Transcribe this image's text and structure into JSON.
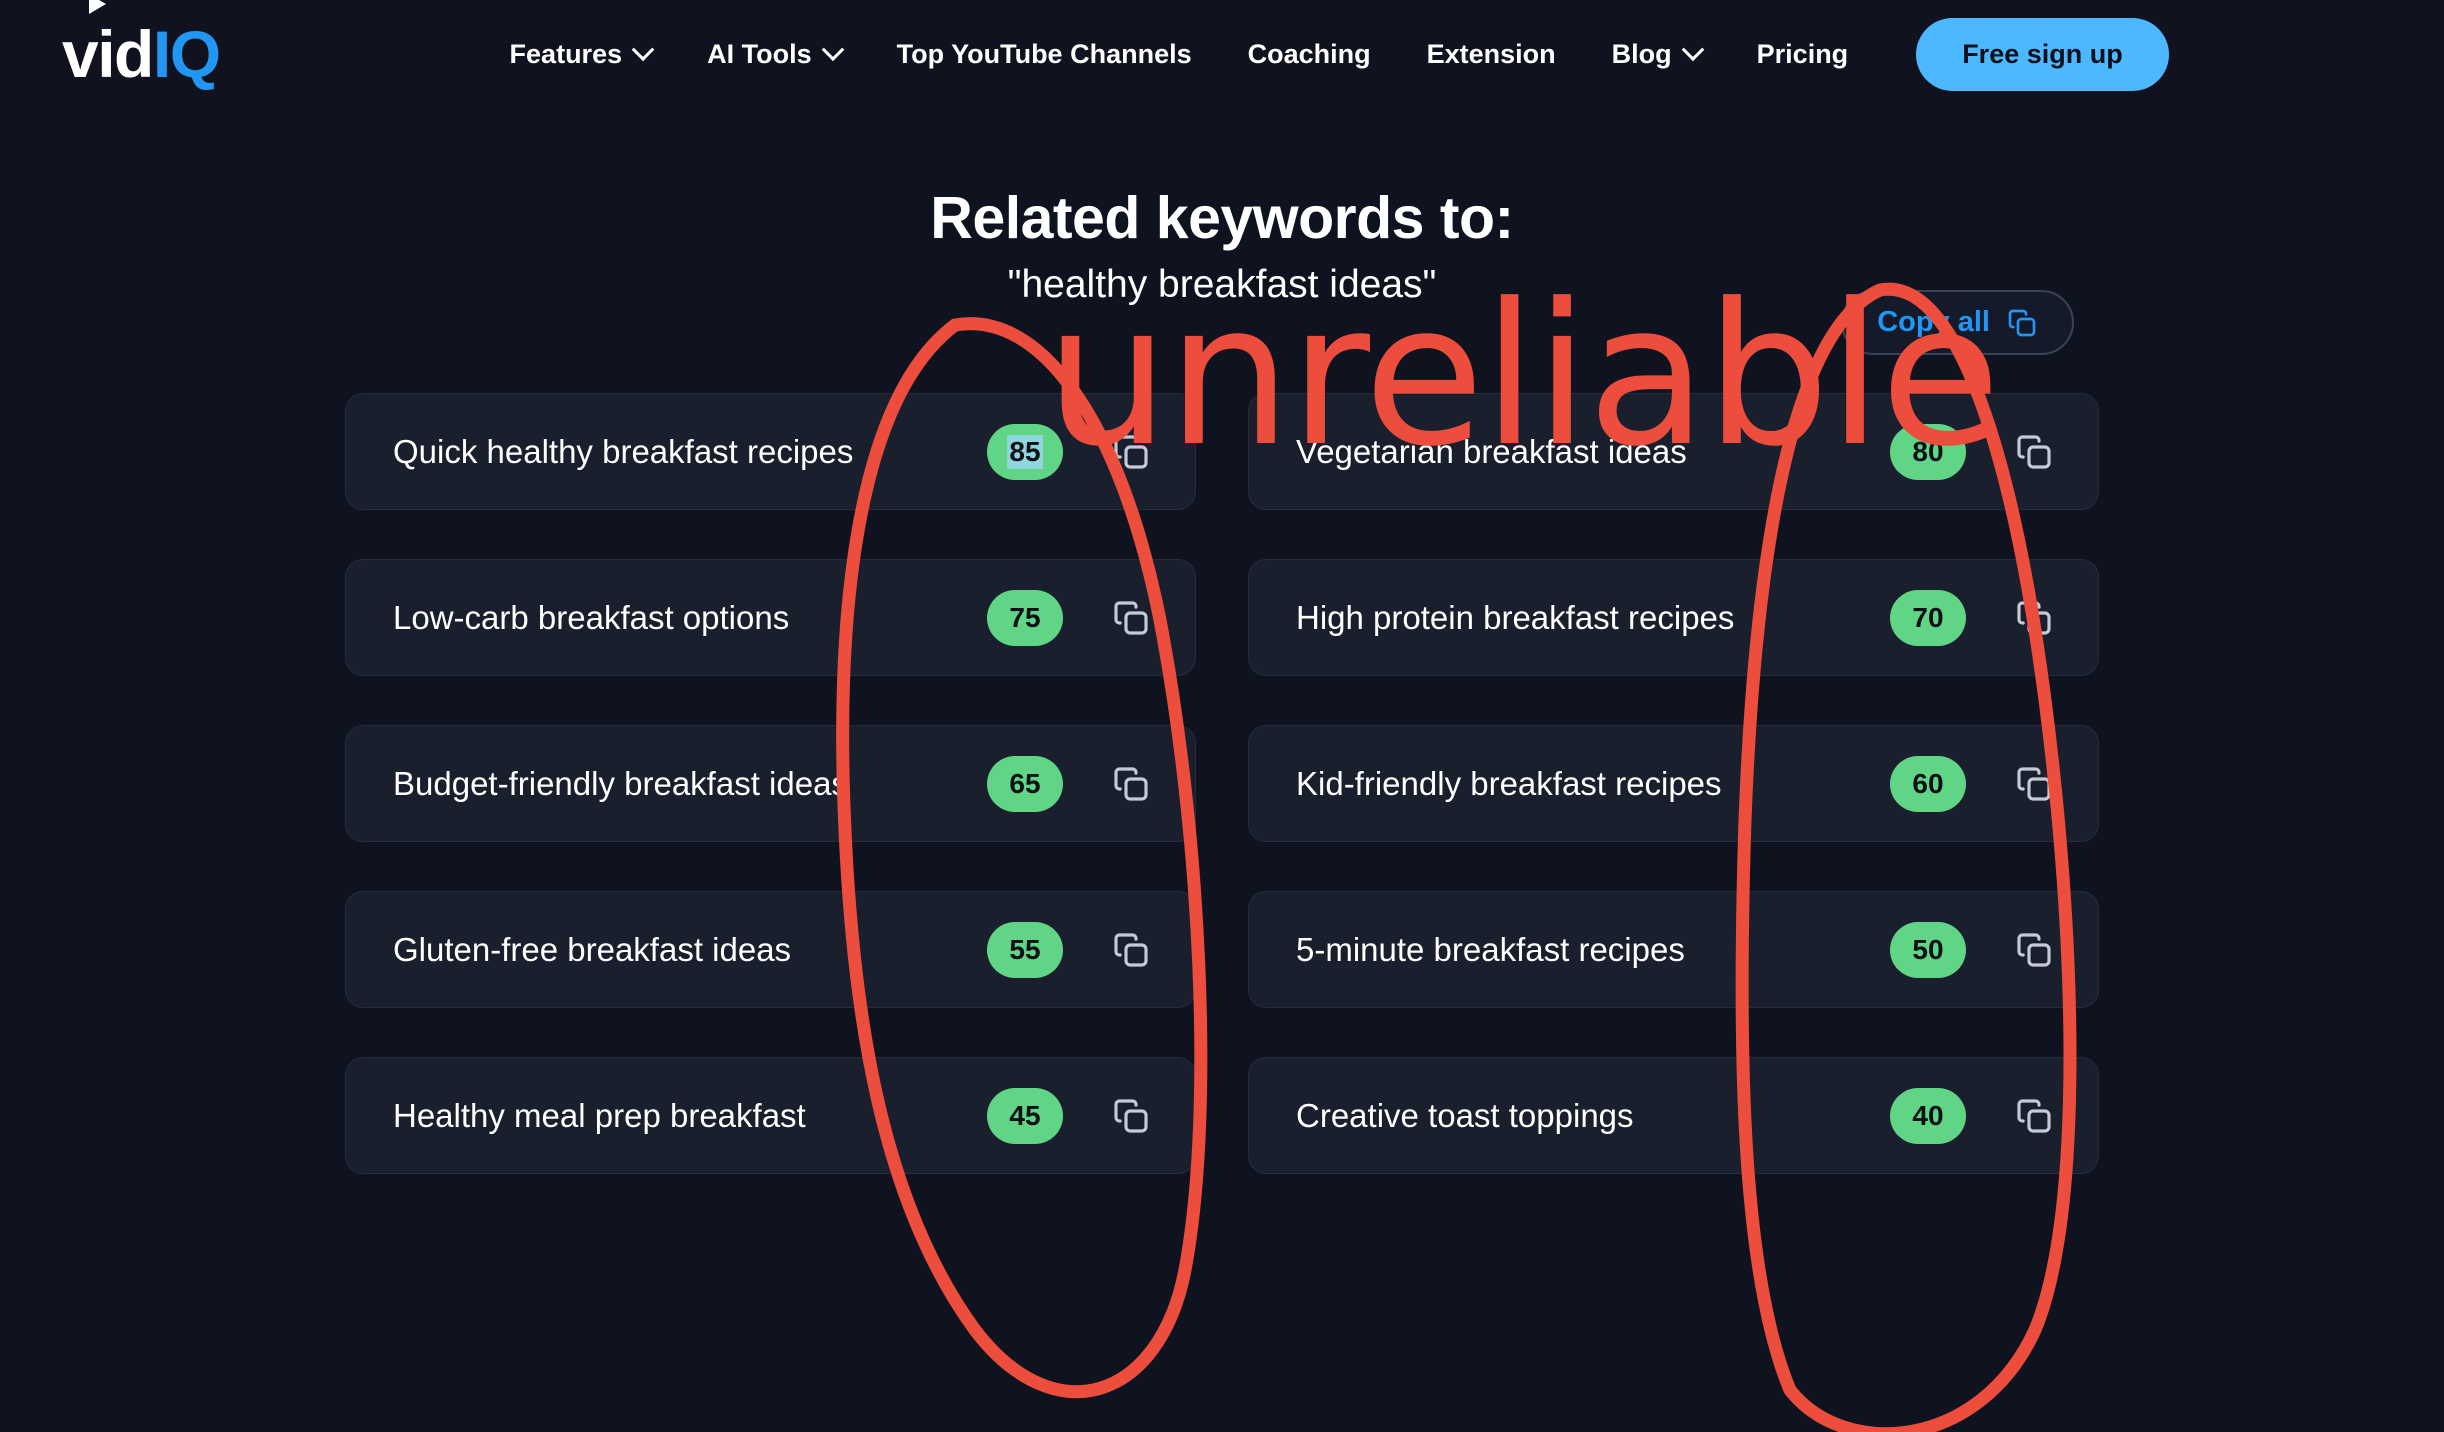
{
  "nav": {
    "logo": {
      "part1": "vid",
      "part2": "IQ"
    },
    "items": [
      {
        "label": "Features",
        "has_dropdown": true
      },
      {
        "label": "AI Tools",
        "has_dropdown": true
      },
      {
        "label": "Top YouTube Channels",
        "has_dropdown": false
      },
      {
        "label": "Coaching",
        "has_dropdown": false
      },
      {
        "label": "Extension",
        "has_dropdown": false
      },
      {
        "label": "Blog",
        "has_dropdown": true
      },
      {
        "label": "Pricing",
        "has_dropdown": false
      }
    ],
    "signup_label": "Free sign up"
  },
  "header": {
    "title": "Related keywords to:",
    "subtitle": "\"healthy breakfast ideas\"",
    "copy_all_label": "Copy all"
  },
  "keywords": [
    {
      "label": "Quick healthy breakfast recipes",
      "score": "85",
      "selected": true
    },
    {
      "label": "Vegetarian breakfast ideas",
      "score": "80",
      "selected": false
    },
    {
      "label": "Low-carb breakfast options",
      "score": "75",
      "selected": false
    },
    {
      "label": "High protein breakfast recipes",
      "score": "70",
      "selected": false
    },
    {
      "label": "Budget-friendly breakfast ideas",
      "score": "65",
      "selected": false
    },
    {
      "label": "Kid-friendly breakfast recipes",
      "score": "60",
      "selected": false
    },
    {
      "label": "Gluten-free breakfast ideas",
      "score": "55",
      "selected": false
    },
    {
      "label": "5-minute breakfast recipes",
      "score": "50",
      "selected": false
    },
    {
      "label": "Healthy meal prep breakfast",
      "score": "45",
      "selected": false
    },
    {
      "label": "Creative toast toppings",
      "score": "40",
      "selected": false
    }
  ],
  "annotation": {
    "text": "unreliable",
    "color": "#ec4d3c",
    "circled_columns": [
      "left-column-scores",
      "right-column-scores"
    ]
  },
  "colors": {
    "page_background": "#0f1320",
    "nav_background": "#10131f",
    "card_background": "#1a1f2e",
    "card_border": "#262c3d",
    "accent_blue": "#2196f3",
    "signup_blue": "#4cb8ff",
    "score_green": "#5fd585",
    "annotation_red": "#ec4d3c",
    "selection_highlight": "#8fd6de"
  }
}
